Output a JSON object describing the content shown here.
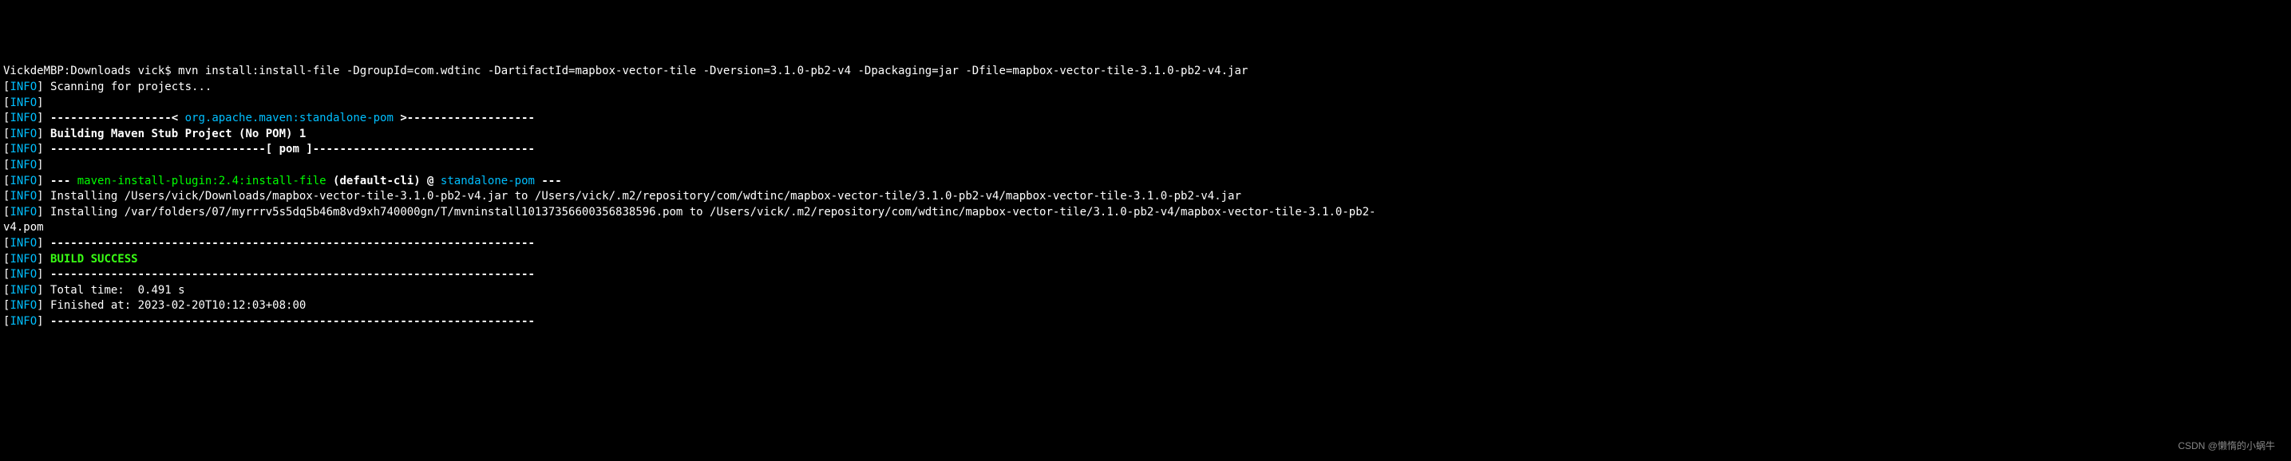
{
  "prompt": {
    "host": "VickdeMBP:Downloads vick$ ",
    "command": "mvn install:install-file -DgroupId=com.wdtinc -DartifactId=mapbox-vector-tile -Dversion=3.1.0-pb2-v4 -Dpackaging=jar -Dfile=mapbox-vector-tile-3.1.0-pb2-v4.jar"
  },
  "info_tag": {
    "open": "[",
    "label": "INFO",
    "close": "]"
  },
  "lines": {
    "scanning": " Scanning for projects...",
    "empty": "",
    "dash_section_pre": " ------------------< ",
    "standalone_pom_id": "org.apache.maven:standalone-pom",
    "dash_section_post": " >-------------------",
    "building": " Building Maven Stub Project (No POM) 1",
    "pom_dashes_pre": " --------------------------------[ pom ]---------------------------------",
    "plugin_pre": " --- ",
    "plugin_name": "maven-install-plugin:2.4:install-file",
    "plugin_mid": " (default-cli) @ ",
    "plugin_target": "standalone-pom",
    "plugin_post": " ---",
    "install_jar": " Installing /Users/vick/Downloads/mapbox-vector-tile-3.1.0-pb2-v4.jar to /Users/vick/.m2/repository/com/wdtinc/mapbox-vector-tile/3.1.0-pb2-v4/mapbox-vector-tile-3.1.0-pb2-v4.jar",
    "install_pom": " Installing /var/folders/07/myrrrv5s5dq5b46m8vd9xh740000gn/T/mvninstall10137356600356838596.pom to /Users/vick/.m2/repository/com/wdtinc/mapbox-vector-tile/3.1.0-pb2-v4/mapbox-vector-tile-3.1.0-pb2-",
    "install_pom_wrap": "v4.pom",
    "separator": " ------------------------------------------------------------------------",
    "build_success": " BUILD SUCCESS",
    "total_time": " Total time:  0.491 s",
    "finished_at": " Finished at: 2023-02-20T10:12:03+08:00"
  },
  "watermark": "CSDN @懒惰的小蜗牛"
}
